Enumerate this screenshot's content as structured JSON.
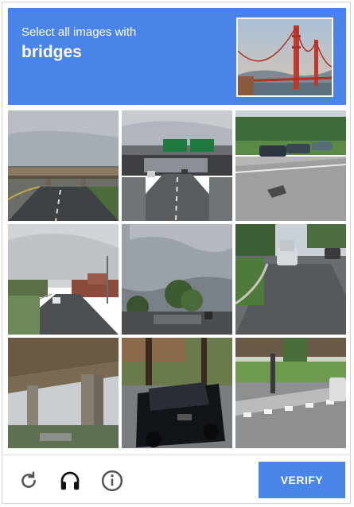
{
  "colors": {
    "accent": "#4a84e8",
    "icon": "#555555"
  },
  "header": {
    "instruction": "Select all images with",
    "target": "bridges",
    "example_image": "golden-gate-bridge"
  },
  "tiles": [
    {
      "subject": "highway-overpass-cloudy"
    },
    {
      "subject": "highway-overpass-green-signs"
    },
    {
      "subject": "street-with-parked-cars"
    },
    {
      "subject": "suburban-road"
    },
    {
      "subject": "stormy-sky-trees"
    },
    {
      "subject": "residential-street-cars"
    },
    {
      "subject": "under-bridge-pillars"
    },
    {
      "subject": "black-suv-street"
    },
    {
      "subject": "crosswalk-street"
    }
  ],
  "controls": {
    "reload_icon": "reload-icon",
    "audio_icon": "headphones-icon",
    "info_icon": "info-icon",
    "verify_label": "VERIFY"
  }
}
